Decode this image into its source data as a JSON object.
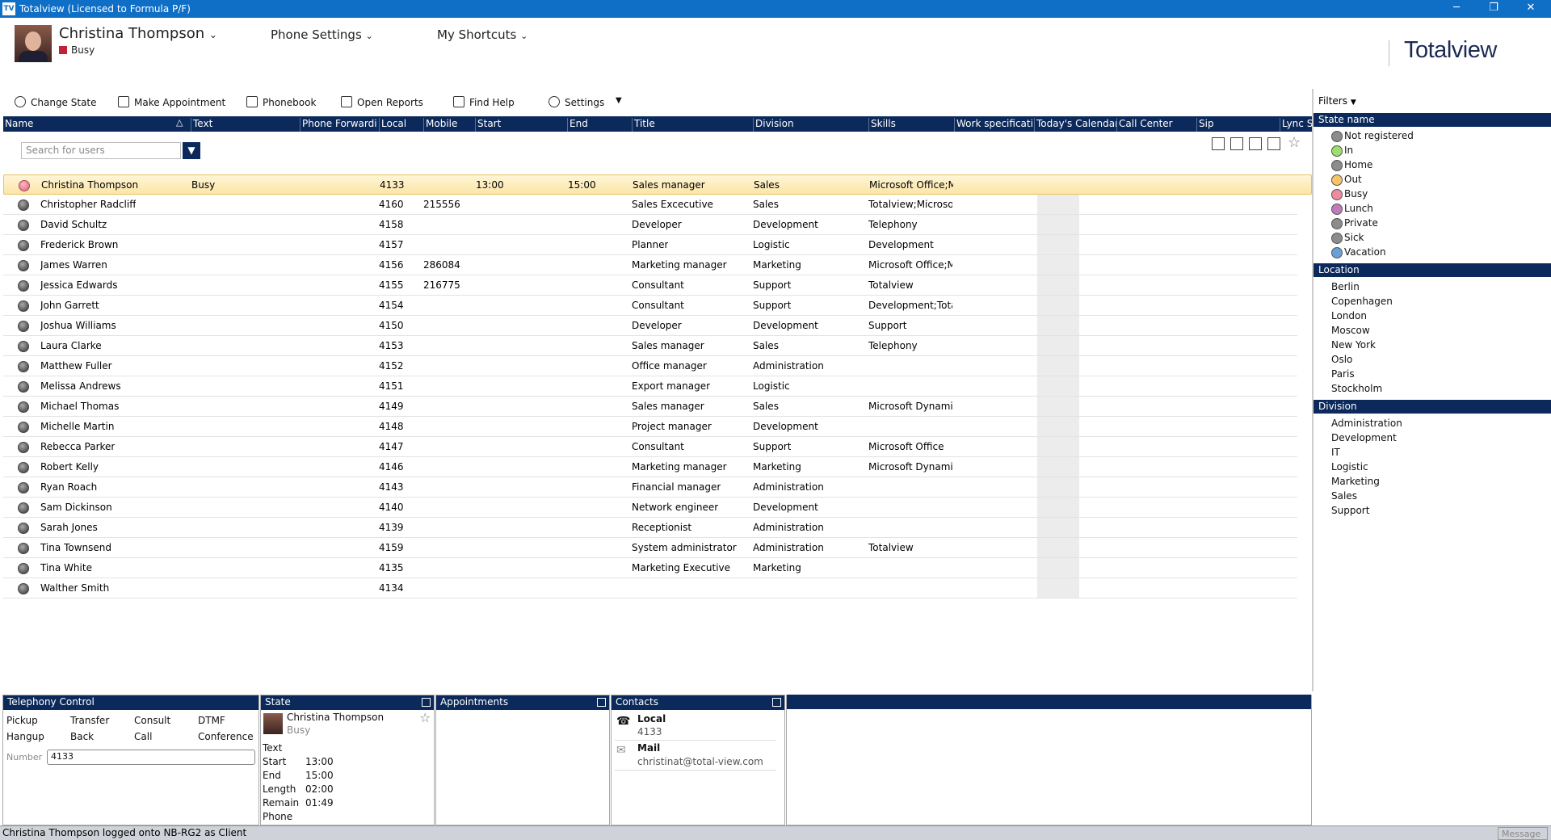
{
  "window": {
    "title": "Totalview  (Licensed to Formula P/F)",
    "logo": "TV",
    "min": "─",
    "restore": "❐",
    "close": "✕"
  },
  "header": {
    "user_name": "Christina Thompson",
    "user_state": "Busy",
    "phone_settings": "Phone Settings",
    "my_shortcuts": "My Shortcuts",
    "brand": "Totalview",
    "dropdown_glyph": "⌄"
  },
  "toolbar": {
    "change_state": "Change State",
    "make_appointment": "Make Appointment",
    "phonebook": "Phonebook",
    "open_reports": "Open Reports",
    "find_help": "Find Help",
    "settings": "Settings",
    "more": "▼"
  },
  "columns": [
    "Name",
    "Text",
    "Phone Forwardi",
    "Local",
    "Mobile",
    "Start",
    "End",
    "Title",
    "Division",
    "Skills",
    "Work specificati",
    "Today's Calendar",
    "Call Center",
    "Sip",
    "Lync St"
  ],
  "search": {
    "placeholder": "Search for users"
  },
  "rows": [
    {
      "name": "Christina Thompson",
      "text": "Busy",
      "local": "4133",
      "mobile": "",
      "start": "13:00",
      "end": "15:00",
      "title": "Sales manager",
      "division": "Sales",
      "skills": "Microsoft Office;M"
    },
    {
      "name": "Christopher Radcliff",
      "text": "",
      "local": "4160",
      "mobile": "215556",
      "start": "",
      "end": "",
      "title": "Sales Excecutive",
      "division": "Sales",
      "skills": "Totalview;Microsof"
    },
    {
      "name": "David Schultz",
      "text": "",
      "local": "4158",
      "mobile": "",
      "start": "",
      "end": "",
      "title": "Developer",
      "division": "Development",
      "skills": "Telephony"
    },
    {
      "name": "Frederick Brown",
      "text": "",
      "local": "4157",
      "mobile": "",
      "start": "",
      "end": "",
      "title": "Planner",
      "division": "Logistic",
      "skills": "Development"
    },
    {
      "name": "James Warren",
      "text": "",
      "local": "4156",
      "mobile": "286084",
      "start": "",
      "end": "",
      "title": "Marketing manager",
      "division": "Marketing",
      "skills": "Microsoft Office;M"
    },
    {
      "name": "Jessica Edwards",
      "text": "",
      "local": "4155",
      "mobile": "216775",
      "start": "",
      "end": "",
      "title": "Consultant",
      "division": "Support",
      "skills": "Totalview"
    },
    {
      "name": "John Garrett",
      "text": "",
      "local": "4154",
      "mobile": "",
      "start": "",
      "end": "",
      "title": "Consultant",
      "division": "Support",
      "skills": "Development;Total"
    },
    {
      "name": "Joshua Williams",
      "text": "",
      "local": "4150",
      "mobile": "",
      "start": "",
      "end": "",
      "title": "Developer",
      "division": "Development",
      "skills": "Support"
    },
    {
      "name": "Laura Clarke",
      "text": "",
      "local": "4153",
      "mobile": "",
      "start": "",
      "end": "",
      "title": "Sales manager",
      "division": "Sales",
      "skills": "Telephony"
    },
    {
      "name": "Matthew Fuller",
      "text": "",
      "local": "4152",
      "mobile": "",
      "start": "",
      "end": "",
      "title": "Office manager",
      "division": "Administration",
      "skills": ""
    },
    {
      "name": "Melissa Andrews",
      "text": "",
      "local": "4151",
      "mobile": "",
      "start": "",
      "end": "",
      "title": "Export manager",
      "division": "Logistic",
      "skills": ""
    },
    {
      "name": "Michael Thomas",
      "text": "",
      "local": "4149",
      "mobile": "",
      "start": "",
      "end": "",
      "title": "Sales manager",
      "division": "Sales",
      "skills": "Microsoft Dynamic"
    },
    {
      "name": "Michelle Martin",
      "text": "",
      "local": "4148",
      "mobile": "",
      "start": "",
      "end": "",
      "title": "Project manager",
      "division": "Development",
      "skills": ""
    },
    {
      "name": "Rebecca Parker",
      "text": "",
      "local": "4147",
      "mobile": "",
      "start": "",
      "end": "",
      "title": "Consultant",
      "division": "Support",
      "skills": "Microsoft Office"
    },
    {
      "name": "Robert Kelly",
      "text": "",
      "local": "4146",
      "mobile": "",
      "start": "",
      "end": "",
      "title": "Marketing manager",
      "division": "Marketing",
      "skills": "Microsoft Dynamic"
    },
    {
      "name": "Ryan Roach",
      "text": "",
      "local": "4143",
      "mobile": "",
      "start": "",
      "end": "",
      "title": "Financial manager",
      "division": "Administration",
      "skills": ""
    },
    {
      "name": "Sam Dickinson",
      "text": "",
      "local": "4140",
      "mobile": "",
      "start": "",
      "end": "",
      "title": "Network engineer",
      "division": "Development",
      "skills": ""
    },
    {
      "name": "Sarah Jones",
      "text": "",
      "local": "4139",
      "mobile": "",
      "start": "",
      "end": "",
      "title": "Receptionist",
      "division": "Administration",
      "skills": ""
    },
    {
      "name": "Tina Townsend",
      "text": "",
      "local": "4159",
      "mobile": "",
      "start": "",
      "end": "",
      "title": "System administrator",
      "division": "Administration",
      "skills": "Totalview"
    },
    {
      "name": "Tina White",
      "text": "",
      "local": "4135",
      "mobile": "",
      "start": "",
      "end": "",
      "title": "Marketing Executive",
      "division": "Marketing",
      "skills": ""
    },
    {
      "name": "Walther Smith",
      "text": "",
      "local": "4134",
      "mobile": "",
      "start": "",
      "end": "",
      "title": "",
      "division": "",
      "skills": ""
    }
  ],
  "filters": {
    "label": "Filters",
    "state_header": "State name",
    "states": [
      {
        "label": "Not registered",
        "color": "#8c8c8c"
      },
      {
        "label": "In",
        "color": "#9be06a"
      },
      {
        "label": "Home",
        "color": "#8c8c8c"
      },
      {
        "label": "Out",
        "color": "#f7c46a"
      },
      {
        "label": "Busy",
        "color": "#f08aa0"
      },
      {
        "label": "Lunch",
        "color": "#c07ac0"
      },
      {
        "label": "Private",
        "color": "#8c8c8c"
      },
      {
        "label": "Sick",
        "color": "#8c8c8c"
      },
      {
        "label": "Vacation",
        "color": "#6aa0d8"
      }
    ],
    "location_header": "Location",
    "locations": [
      "Berlin",
      "Copenhagen",
      "London",
      "Moscow",
      "New York",
      "Oslo",
      "Paris",
      "Stockholm"
    ],
    "division_header": "Division",
    "divisions": [
      "Administration",
      "Development",
      "IT",
      "Logistic",
      "Marketing",
      "Sales",
      "Support"
    ]
  },
  "telephony": {
    "header": "Telephony Control",
    "pickup": "Pickup",
    "transfer": "Transfer",
    "consult": "Consult",
    "dtmf": "DTMF",
    "hangup": "Hangup",
    "back": "Back",
    "call": "Call",
    "conference": "Conference",
    "number_label": "Number",
    "number_value": "4133"
  },
  "state_pane": {
    "header": "State",
    "name": "Christina Thompson",
    "state": "Busy",
    "text_label": "Text",
    "start_label": "Start",
    "start": "13:00",
    "end_label": "End",
    "end": "15:00",
    "length_label": "Length",
    "length": "02:00",
    "remain_label": "Remain",
    "remain": "01:49",
    "phone_label": "Phone"
  },
  "appointments": {
    "header": "Appointments"
  },
  "contacts": {
    "header": "Contacts",
    "local_label": "Local",
    "local_value": "4133",
    "mail_label": "Mail",
    "mail_value": "christinat@total-view.com"
  },
  "status": {
    "text": "Christina Thompson logged onto NB-RG2 as Client",
    "message_label": "Message"
  },
  "colors": {
    "accent": "#0f6fc6",
    "header_navy": "#0b2a5b",
    "busy": "#c3203a",
    "selected_row": "#fbe6a8"
  }
}
